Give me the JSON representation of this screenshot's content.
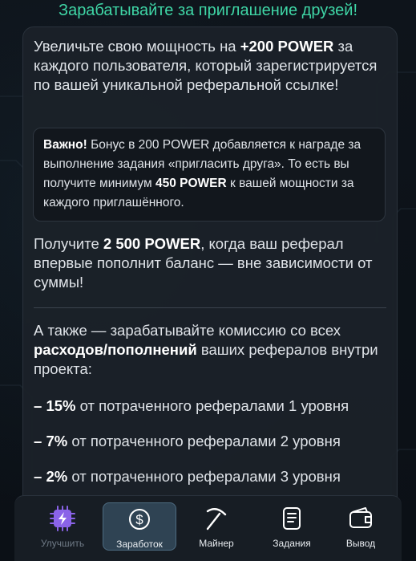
{
  "header": {
    "title": "Зарабатывайте за приглашение друзей!"
  },
  "intro": {
    "part1": "Увеличьте свою мощность на ",
    "bold": "+200 POWER",
    "part2": " за каждого пользователя, который зарегистрируется по вашей уникальной реферальной ссылке!"
  },
  "note": {
    "label": "Важно!",
    "part1": " Бонус в 200 POWER добавляется к награде за выполнение задания «пригласить друга». То есть вы получите минимум ",
    "bold": "450 POWER",
    "part2": " к вашей мощности за каждого приглашённого."
  },
  "deposit": {
    "part1": "Получите ",
    "bold": "2 500 POWER",
    "part2": ", когда ваш реферал впервые пополнит баланс — вне зависимости от суммы!"
  },
  "commission": {
    "part1": "А также — зарабатывайте комиссию со всех ",
    "bold": "расходов/пополнений",
    "part2": " ваших рефералов внутри проекта:"
  },
  "levels": [
    {
      "prefix": "– ",
      "percent": "15%",
      "text": " от потраченного рефералами 1 уровня"
    },
    {
      "prefix": "– ",
      "percent": "7%",
      "text": " от потраченного рефералами 2 уровня"
    },
    {
      "prefix": "– ",
      "percent": "2%",
      "text": " от потраченного рефералами 3 уровня"
    }
  ],
  "nav": {
    "items": [
      {
        "label": "Улучшить",
        "icon": "chip-bolt-icon"
      },
      {
        "label": "Заработок",
        "icon": "dollar-coin-icon"
      },
      {
        "label": "Майнер",
        "icon": "pickaxe-icon"
      },
      {
        "label": "Задания",
        "icon": "tasks-list-icon"
      },
      {
        "label": "Вывод",
        "icon": "wallet-icon"
      }
    ],
    "active": "Заработок"
  },
  "colors": {
    "title": "#3fd6a6",
    "chip_purple": "#8a63e8",
    "active_tab": "#2f4353"
  }
}
